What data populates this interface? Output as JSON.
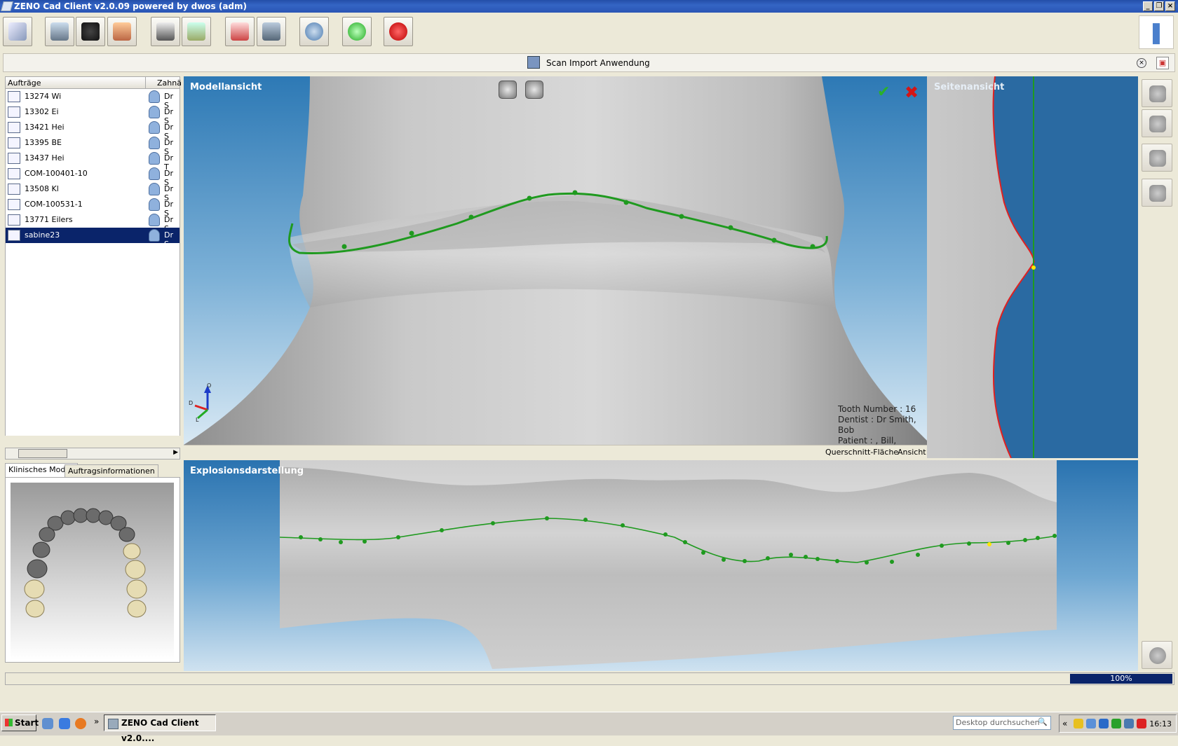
{
  "window": {
    "title": "ZENO Cad Client v2.0.09 powered by dwos (adm)"
  },
  "subbar": {
    "label": "Scan Import Anwendung"
  },
  "orders": {
    "col_orders": "Aufträge",
    "col_tooth": "Zahnä",
    "rows": [
      {
        "name": "13274 Wi",
        "dentist": "Dr S"
      },
      {
        "name": "13302 Ei",
        "dentist": "Dr S"
      },
      {
        "name": "13421 Hei",
        "dentist": "Dr S"
      },
      {
        "name": "13395 BE",
        "dentist": "Dr S"
      },
      {
        "name": "13437 Hei",
        "dentist": "Dr T"
      },
      {
        "name": "COM-100401-10",
        "dentist": "Dr S"
      },
      {
        "name": "13508 Kl",
        "dentist": "Dr S"
      },
      {
        "name": "COM-100531-1",
        "dentist": "Dr S"
      },
      {
        "name": "13771 Eilers",
        "dentist": "Dr S"
      },
      {
        "name": "sabine23",
        "dentist": "Dr S",
        "selected": true
      }
    ]
  },
  "tabs": {
    "clinical": "Klinisches Modell",
    "orderinfo": "Auftragsinformationen"
  },
  "model_view": {
    "title": "Modellansicht",
    "tooth_number": "Tooth Number : 16",
    "dentist": "Dentist : Dr Smith, Bob",
    "patient": "Patient : , Bill, Fletcher",
    "axis_o": "O",
    "axis_d": "D",
    "axis_l": "L"
  },
  "model_status": {
    "cross_section": "Querschnitt-Fläche",
    "view": "Ansicht"
  },
  "side_view": {
    "title": "Seitenansicht"
  },
  "explode_view": {
    "title": "Explosionsdarstellung"
  },
  "status": {
    "progress": "100%",
    "progress_value": 1.0
  },
  "taskbar": {
    "start": "Start",
    "task_item": "ZENO Cad Client v2.0....",
    "search_placeholder": "Desktop durchsuchen",
    "clock": "16:13"
  },
  "colors": {
    "margin_line": "#1f9a1f",
    "title_bar": "#2a55b5",
    "selection": "#0a246a",
    "profile_line": "#e02020"
  }
}
